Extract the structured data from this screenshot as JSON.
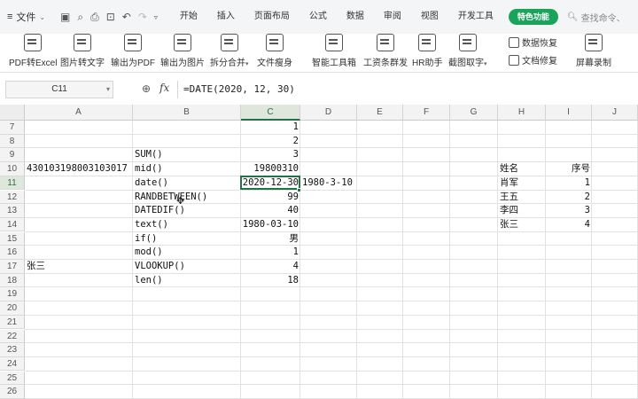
{
  "menubar": {
    "file_label": "文件",
    "menus": [
      "开始",
      "插入",
      "页面布局",
      "公式",
      "数据",
      "审阅",
      "视图",
      "开发工具"
    ],
    "special_label": "特色功能",
    "search_placeholder": "查找命令、"
  },
  "toolbar": {
    "tools": [
      {
        "label": "PDF转Excel",
        "icon": "pdf-excel-icon"
      },
      {
        "label": "图片转文字",
        "icon": "image-text-icon"
      },
      {
        "label": "输出为PDF",
        "icon": "export-pdf-icon"
      },
      {
        "label": "输出为图片",
        "icon": "export-image-icon"
      },
      {
        "label": "拆分合并",
        "icon": "split-merge-icon"
      },
      {
        "label": "文件瘦身",
        "icon": "file-slim-icon"
      },
      {
        "label": "智能工具箱",
        "icon": "smart-toolbox-icon"
      },
      {
        "label": "工资条群发",
        "icon": "payslip-icon"
      },
      {
        "label": "HR助手",
        "icon": "hr-assistant-icon"
      },
      {
        "label": "截图取字",
        "icon": "screenshot-text-icon"
      }
    ],
    "side_tools": [
      "数据恢复",
      "文档修复"
    ],
    "far_tools": [
      "屏幕录制"
    ]
  },
  "formula_bar": {
    "cell_ref": "C11",
    "formula": "=DATE(2020, 12, 30)"
  },
  "columns": [
    "A",
    "B",
    "C",
    "D",
    "E",
    "F",
    "G",
    "H",
    "I",
    "J"
  ],
  "active_column": "C",
  "rows": [
    "7",
    "8",
    "9",
    "10",
    "11",
    "12",
    "13",
    "14",
    "15",
    "16",
    "17",
    "18",
    "19",
    "20",
    "21",
    "22",
    "23",
    "24",
    "25",
    "26"
  ],
  "active_row": "11",
  "cells": {
    "C7": "1",
    "C8": "2",
    "B9": "SUM()",
    "C9": "3",
    "A10": "430103198003103017",
    "B10": "mid()",
    "C10": "19800310",
    "B11": "date()",
    "C11": "2020-12-30",
    "D11": "1980-3-10",
    "B12": "RANDBETWEEN()",
    "C12": "99",
    "B13": "DATEDIF()",
    "C13": "40",
    "B14": "text()",
    "C14": "1980-03-10",
    "B15": "if()",
    "C15": "男",
    "B16": "mod()",
    "C16": "1",
    "A17": "张三",
    "B17": "VLOOKUP()",
    "C17": "4",
    "B18": "len()",
    "C18": "18",
    "H10": "姓名",
    "I10": "序号",
    "H11": "肖军",
    "I11": "1",
    "H12": "王五",
    "I12": "2",
    "H13": "李四",
    "I13": "3",
    "H14": "张三",
    "I14": "4"
  }
}
